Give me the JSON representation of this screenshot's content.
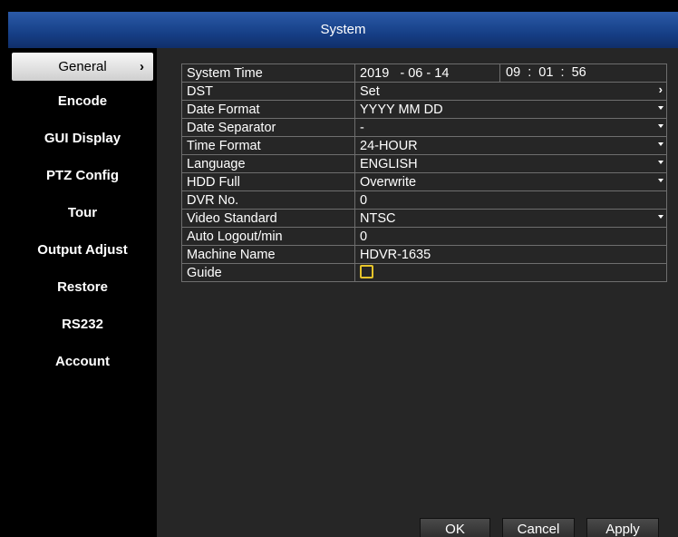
{
  "window": {
    "title": "System"
  },
  "sidebar": {
    "items": [
      {
        "label": "General",
        "active": true
      },
      {
        "label": "Encode"
      },
      {
        "label": "GUI Display"
      },
      {
        "label": "PTZ Config"
      },
      {
        "label": "Tour"
      },
      {
        "label": "Output Adjust"
      },
      {
        "label": "Restore"
      },
      {
        "label": "RS232"
      },
      {
        "label": "Account"
      }
    ]
  },
  "settings": {
    "system_time": {
      "label": "System Time",
      "year": "2019",
      "month": "06",
      "day": "14",
      "hour": "09",
      "minute": "01",
      "second": "56",
      "date_sep": "-",
      "time_sep": ":"
    },
    "dst": {
      "label": "DST",
      "value": "Set"
    },
    "date_format": {
      "label": "Date Format",
      "value": "YYYY MM DD"
    },
    "date_separator": {
      "label": "Date Separator",
      "value": "-"
    },
    "time_format": {
      "label": "Time Format",
      "value": "24-HOUR"
    },
    "language": {
      "label": "Language",
      "value": "ENGLISH"
    },
    "hdd_full": {
      "label": "HDD Full",
      "value": "Overwrite"
    },
    "dvr_no": {
      "label": "DVR No.",
      "value": "0"
    },
    "video_standard": {
      "label": "Video Standard",
      "value": "NTSC"
    },
    "auto_logout": {
      "label": "Auto Logout/min",
      "value": "0"
    },
    "machine_name": {
      "label": "Machine Name",
      "value": "HDVR-1635"
    },
    "guide": {
      "label": "Guide",
      "checked": false
    }
  },
  "buttons": {
    "ok": "OK",
    "cancel": "Cancel",
    "apply": "Apply"
  },
  "colors": {
    "title_bar": "#1f4d9a",
    "checkbox_border": "#e6c42a",
    "panel_bg": "#262626"
  },
  "icons": {
    "active_arrow": "chevron-right-icon",
    "dropdown": "caret-down-icon"
  }
}
